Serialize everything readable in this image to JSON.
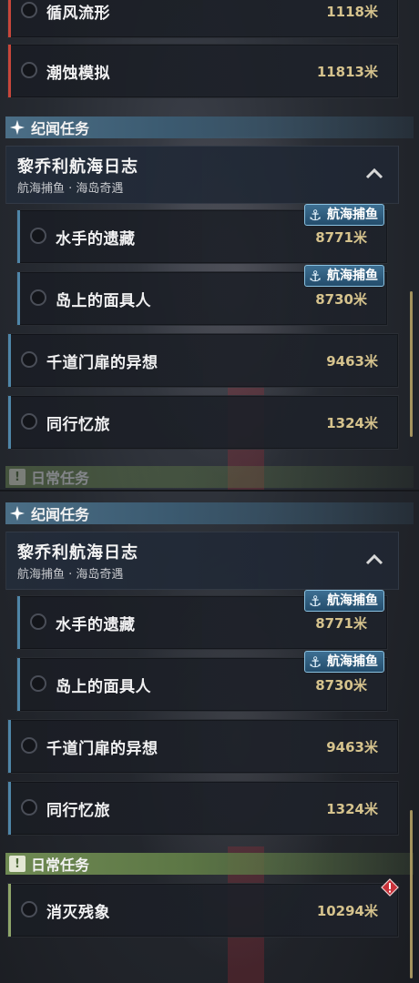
{
  "top": {
    "rows_top": [
      {
        "title": "循风流形",
        "distance": "1118米"
      },
      {
        "title": "潮蚀模拟",
        "distance": "11813米"
      }
    ],
    "section_story": {
      "label": "纪闻任务"
    },
    "group": {
      "title": "黎乔利航海日志",
      "subtitle": "航海捕鱼 · 海岛奇遇"
    },
    "sub_rows": [
      {
        "title": "水手的遗藏",
        "distance": "8771米",
        "tag": "航海捕鱼"
      },
      {
        "title": "岛上的面具人",
        "distance": "8730米",
        "tag": "航海捕鱼"
      }
    ],
    "rows": [
      {
        "title": "千道门扉的异想",
        "distance": "9463米"
      },
      {
        "title": "同行忆旅",
        "distance": "1324米"
      }
    ],
    "section_daily_partial": {
      "label": "日常任务"
    }
  },
  "bottom": {
    "section_story": {
      "label": "纪闻任务"
    },
    "group": {
      "title": "黎乔利航海日志",
      "subtitle": "航海捕鱼 · 海岛奇遇"
    },
    "sub_rows": [
      {
        "title": "水手的遗藏",
        "distance": "8771米",
        "tag": "航海捕鱼"
      },
      {
        "title": "岛上的面具人",
        "distance": "8730米",
        "tag": "航海捕鱼"
      }
    ],
    "rows": [
      {
        "title": "千道门扉的异想",
        "distance": "9463米"
      },
      {
        "title": "同行忆旅",
        "distance": "1324米"
      }
    ],
    "section_daily": {
      "label": "日常任务"
    },
    "daily_rows": [
      {
        "title": "消灭残象",
        "distance": "10294米"
      }
    ]
  },
  "colors": {
    "stripe_red": "#c8463a",
    "stripe_blue": "#4f86a8",
    "stripe_daily": "#8fa66a",
    "distance_gold": "#d6c38d",
    "alert_red": "#c8323a"
  }
}
